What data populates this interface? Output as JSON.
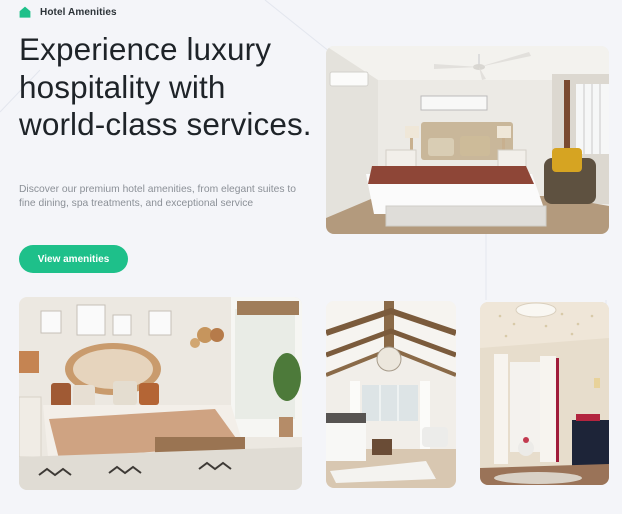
{
  "brand": {
    "name": "Hotel Amenities",
    "icon": "house-icon",
    "color": "#1ec08a"
  },
  "hero": {
    "headline": "Experience luxury hospitality with world-class services.",
    "description": "Discover our premium hotel amenities, from elegant suites to fine dining, spa treatments, and exceptional service",
    "cta_label": "View amenities"
  },
  "colors": {
    "accent": "#1ec08a",
    "heading": "#1e2328",
    "body_text": "#8b9097",
    "background": "#f4f5f9"
  }
}
